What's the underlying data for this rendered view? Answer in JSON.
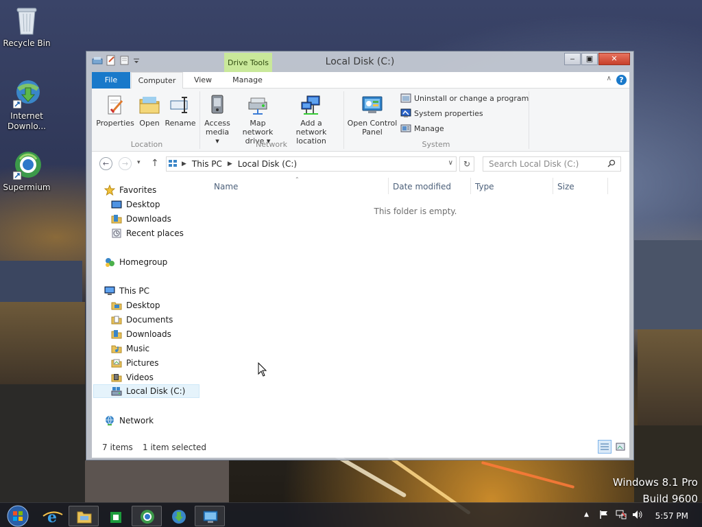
{
  "desktop": {
    "icons": [
      {
        "label": "Recycle Bin",
        "icon": "recycle-bin-icon"
      },
      {
        "label": "Internet Downlo...",
        "icon": "internet-download-manager-icon"
      },
      {
        "label": "Supermium",
        "icon": "supermium-icon"
      }
    ],
    "watermark_line1": "Windows 8.1 Pro",
    "watermark_line2": "Build 9600"
  },
  "window": {
    "title": "Local Disk (C:)",
    "context_tab": "Drive Tools",
    "tabs": [
      {
        "label": "File"
      },
      {
        "label": "Computer"
      },
      {
        "label": "View"
      },
      {
        "label": "Manage"
      }
    ],
    "ribbon": {
      "location": {
        "label": "Location",
        "buttons": [
          {
            "label": "Properties",
            "icon": "properties-icon"
          },
          {
            "label": "Open",
            "icon": "open-icon"
          },
          {
            "label": "Rename",
            "icon": "rename-icon"
          }
        ]
      },
      "network": {
        "label": "Network",
        "buttons": [
          {
            "label_line1": "Access",
            "label_line2": "media ▾",
            "icon": "access-media-icon"
          },
          {
            "label_line1": "Map network",
            "label_line2": "drive ▾",
            "icon": "map-network-drive-icon"
          },
          {
            "label_line1": "Add a network",
            "label_line2": "location",
            "icon": "add-network-location-icon"
          }
        ]
      },
      "system": {
        "label": "System",
        "big_button_line1": "Open Control",
        "big_button_line2": "Panel",
        "small_buttons": [
          {
            "label": "Uninstall or change a program",
            "icon": "uninstall-program-icon"
          },
          {
            "label": "System properties",
            "icon": "system-properties-icon"
          },
          {
            "label": "Manage",
            "icon": "manage-icon"
          }
        ]
      }
    },
    "address": {
      "crumbs": [
        "This PC",
        "Local Disk (C:)"
      ]
    },
    "search": {
      "placeholder": "Search Local Disk (C:)"
    },
    "nav": {
      "favorites": "Favorites",
      "fav_items": [
        "Desktop",
        "Downloads",
        "Recent places"
      ],
      "homegroup": "Homegroup",
      "thispc": "This PC",
      "pc_items": [
        "Desktop",
        "Documents",
        "Downloads",
        "Music",
        "Pictures",
        "Videos",
        "Local Disk (C:)"
      ],
      "network": "Network"
    },
    "columns": [
      "Name",
      "Date modified",
      "Type",
      "Size"
    ],
    "empty_message": "This folder is empty.",
    "status": {
      "items": "7 items",
      "selected": "1 item selected"
    }
  },
  "taskbar": {
    "clock": "5:57 PM"
  }
}
